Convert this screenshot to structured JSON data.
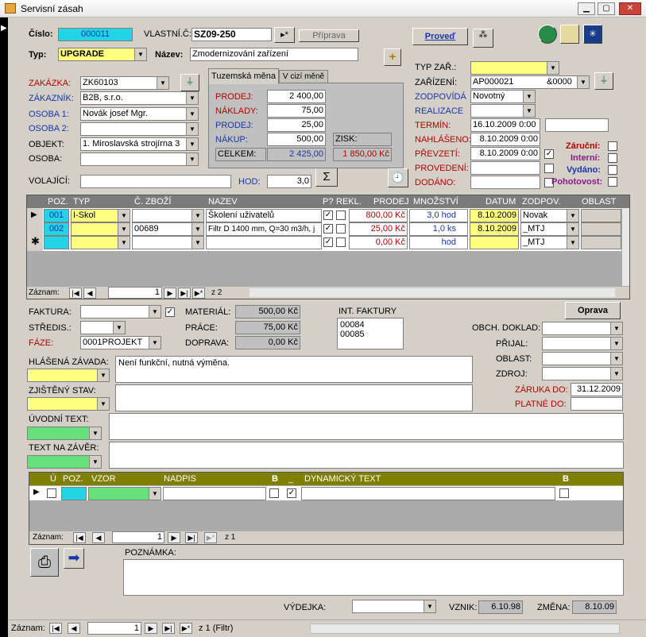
{
  "window": {
    "title": "Servisní zásah",
    "min": "▁",
    "max": "▢",
    "close": "✕"
  },
  "top": {
    "cislo_label": "Číslo:",
    "cislo": "000011",
    "vlastni_label": "VLASTNÍ.Č:",
    "vlastni": "SZ09-250",
    "arrow": "▸*",
    "priprava": "Příprava",
    "proved": "Proveď",
    "typ_label": "Typ:",
    "typ": "UPGRADE",
    "nazev_label": "Název:",
    "nazev": "Zmodernizování zařízení",
    "plus": "+"
  },
  "left": {
    "zakazka_label": "ZAKÁZKA:",
    "zakazka": "ZK60103",
    "zakaznik_label": "ZÁKAZNÍK:",
    "zakaznik": "B2B, s.r.o.",
    "osoba1_label": "OSOBA 1:",
    "osoba1": "Novák josef Mgr.",
    "osoba2_label": "OSOBA 2:",
    "osoba2": "",
    "objekt_label": "OBJEKT:",
    "objekt": "1. Miroslavská strojírna 3",
    "osoba_label": "OSOBA:",
    "osoba": "",
    "volajici_label": "VOLAJÍCÍ:",
    "volajici": "",
    "hod_label": "HOD:",
    "hod": "3,0",
    "sigma": "Σ",
    "clock": "🕘"
  },
  "prices": {
    "tab1": "Tuzemská měna",
    "tab2": "V cizí měně",
    "prodej_label": "PRODEJ:",
    "prodej": "2 400,00",
    "naklady_label": "NÁKLADY:",
    "naklady": "75,00",
    "prodej2_label": "PRODEJ:",
    "prodej2": "25,00",
    "nakup_label": "NÁKUP:",
    "nakup": "500,00",
    "zisk_label": "ZISK:",
    "celkem_label": "CELKEM:",
    "celkem": "2 425,00",
    "zisk": "1 850,00 Kč"
  },
  "right": {
    "typzar_label": "TYP ZAŘ.:",
    "typzar": "",
    "zarizeni_label": "ZAŘÍZENÍ:",
    "zarizeni": "AP000021",
    "zarizeni2": "&0000",
    "zodpovida_label": "ZODPOVÍDÁ",
    "zodpovida": "Novotný",
    "realizace_label": "REALIZACE",
    "realizace": "",
    "termin_label": "TERMÍN:",
    "termin": "16.10.2009 0:00",
    "nahlaseno_label": "NAHLÁŠENO:",
    "nahlaseno": "8.10.2009 0:00",
    "prevzeti_label": "PŘEVZETÍ:",
    "prevzeti": "8.10.2009 0:00",
    "provedeni_label": "PROVEDENÍ:",
    "dodano_label": "DODÁNO:",
    "zarucni": "Záruční:",
    "interni": "Interní:",
    "vydano": "Vydáno:",
    "pohotovost": "Pohotovost:"
  },
  "grid1": {
    "headers": [
      "POZ.",
      "TYP",
      "Č. ZBOŽÍ",
      "NAZEV",
      "P?",
      "REKL.",
      "PRODEJ",
      "MNOŽSTVÍ",
      "DATUM",
      "ZODPOV.",
      "OBLAST"
    ],
    "rows": [
      {
        "poz": "001",
        "typ": "I-Skol",
        "zbozi": "",
        "nazev": "Školení uživatelů",
        "prodej": "800,00 Kč",
        "mnozstvi": "3,0 hod",
        "datum": "8.10.2009",
        "zodpov": "Novak"
      },
      {
        "poz": "002",
        "typ": "",
        "zbozi": "00689",
        "nazev": "Filtr D 1400 mm, Q=30 m3/h, j",
        "prodej": "25,00 Kč",
        "mnozstvi": "1,0 ks",
        "datum": "8.10.2009",
        "zodpov": "_MTJ"
      },
      {
        "poz": "",
        "typ": "",
        "zbozi": "",
        "nazev": "",
        "prodej": "0,00 Kč",
        "mnozstvi": "hod",
        "datum": "",
        "zodpov": "_MTJ"
      }
    ],
    "nav_label": "Záznam:",
    "nav_pos": "1",
    "nav_total": "z 2"
  },
  "mid": {
    "faktura_label": "FAKTURA:",
    "stredis_label": "STŘEDIS.:",
    "faze_label": "FÁZE:",
    "faze": "0001PROJEKT",
    "material_label": "MATERIÁL:",
    "material": "500,00 Kč",
    "prace_label": "PRÁCE:",
    "prace": "75,00 Kč",
    "doprava_label": "DOPRAVA:",
    "doprava": "0,00 Kč",
    "int_label": "INT. FAKTURY",
    "int1": "00084",
    "int2": "00085",
    "oprava": "Oprava",
    "obch_label": "OBCH. DOKLAD:",
    "prijal_label": "PŘIJAL:",
    "oblast_label": "OBLAST:",
    "zdroj_label": "ZDROJ:",
    "zaruka_label": "ZÁRUKA DO:",
    "zaruka": "31.12.2009",
    "platne_label": "PLATNÉ DO:"
  },
  "texts": {
    "hlasena_label": "HLÁŠENÁ ZÁVADA:",
    "hlasena": "Není funkční, nutná výměna.",
    "zjisteny_label": "ZJIŠTĚNÝ STAV:",
    "uvodni_label": "ÚVODNÍ TEXT:",
    "zaver_label": "TEXT NA ZÁVĚR:"
  },
  "grid2": {
    "headers": [
      "Ú",
      "POZ.",
      "VZOR",
      "NADPIS",
      "B",
      "_",
      "DYNAMICKÝ TEXT",
      "B"
    ],
    "nav_label": "Záznam:",
    "nav_pos": "1",
    "nav_total": "z 1"
  },
  "bottom": {
    "poznamka_label": "POZNÁMKA:",
    "vydejka_label": "VÝDEJKA:",
    "vznik_label": "VZNIK:",
    "vznik": "6.10.98",
    "zmena_label": "ZMĚNA:",
    "zmena": "8.10.09",
    "nav_label": "Záznam:",
    "nav_pos": "1",
    "nav_total": "z  1 (Filtr)"
  }
}
